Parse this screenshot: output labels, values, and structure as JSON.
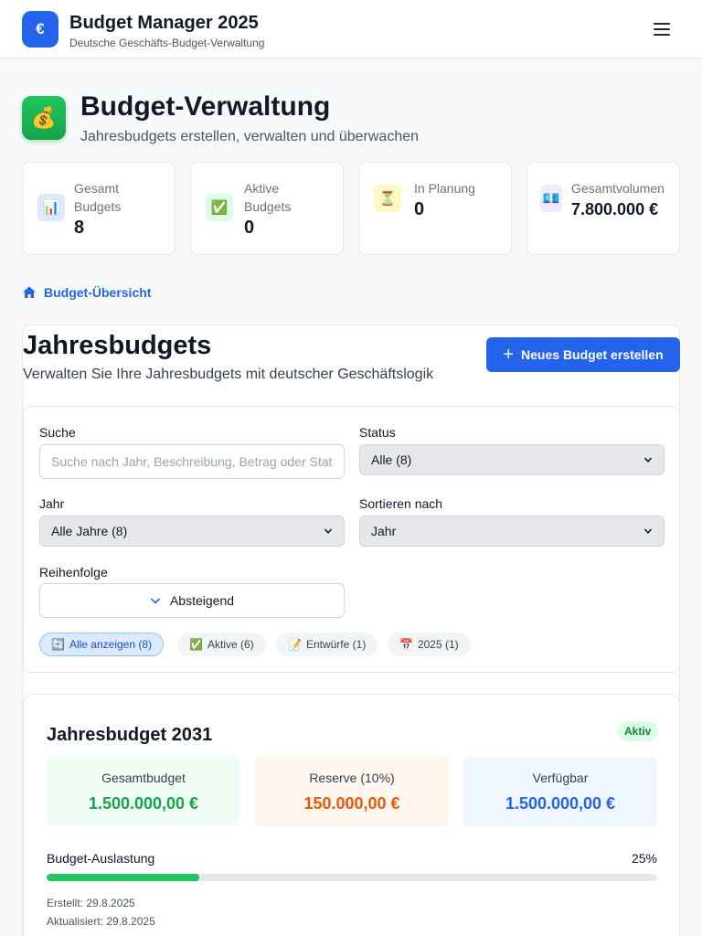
{
  "app": {
    "logo_symbol": "€",
    "title": "Budget Manager 2025",
    "subtitle": "Deutsche Geschäfts-Budget-Verwaltung",
    "menu_icon": "hamburger-icon"
  },
  "page": {
    "icon": "💰",
    "title": "Budget-Verwaltung",
    "subtitle": "Jahresbudgets erstellen, verwalten und überwachen"
  },
  "stats": [
    {
      "icon": "📊",
      "label": "Gesamt Budgets",
      "value": "8",
      "icon_bg": "#dbeafe"
    },
    {
      "icon": "✅",
      "label": "Aktive Budgets",
      "value": "0",
      "icon_bg": "#dcfce7"
    },
    {
      "icon": "⏳",
      "label": "In Planung",
      "value": "0",
      "icon_bg": "#fef9c3"
    },
    {
      "icon": "💶",
      "label": "Gesamtvolumen",
      "value": "7.800.000 €",
      "icon_bg": "#f3e8ff"
    }
  ],
  "breadcrumb": {
    "label": "Budget-Übersicht",
    "icon": "home-icon"
  },
  "section": {
    "title": "Jahresbudgets",
    "subtitle": "Verwalten Sie Ihre Jahresbudgets mit deutscher Geschäftslogik",
    "new_button": "Neues Budget erstellen"
  },
  "filters": {
    "search_label": "Suche",
    "search_placeholder": "Suche nach Jahr, Beschreibung, Betrag oder Status...",
    "search_value": "",
    "status_label": "Status",
    "status_value": "Alle (8)",
    "year_label": "Jahr",
    "year_value": "Alle Jahre (8)",
    "sort_label": "Sortieren nach",
    "sort_value": "Jahr",
    "order_label": "Reihenfolge",
    "order_value": "Absteigend",
    "chips": [
      {
        "icon": "🔄",
        "label": "Alle anzeigen (8)"
      },
      {
        "icon": "✅",
        "label": "Aktive (6)"
      },
      {
        "icon": "📝",
        "label": "Entwürfe (1)"
      },
      {
        "icon": "📅",
        "label": "2025 (1)"
      }
    ]
  },
  "budget": {
    "title": "Jahresbudget 2031",
    "status": "Aktiv",
    "kpis": [
      {
        "label": "Gesamtbudget",
        "value": "1.500.000,00 €",
        "bg": "#f0fdf4",
        "color": "#16a34a"
      },
      {
        "label": "Reserve (10%)",
        "value": "150.000,00 €",
        "bg": "#fff7ed",
        "color": "#ea580c"
      },
      {
        "label": "Verfügbar",
        "value": "1.500.000,00 €",
        "bg": "#eff6ff",
        "color": "#2563eb"
      }
    ],
    "usage_label": "Budget-Auslastung",
    "usage_percent": 25,
    "usage_percent_label": "25%",
    "created": "Erstellt: 29.8.2025",
    "updated": "Aktualisiert: 29.8.2025"
  }
}
